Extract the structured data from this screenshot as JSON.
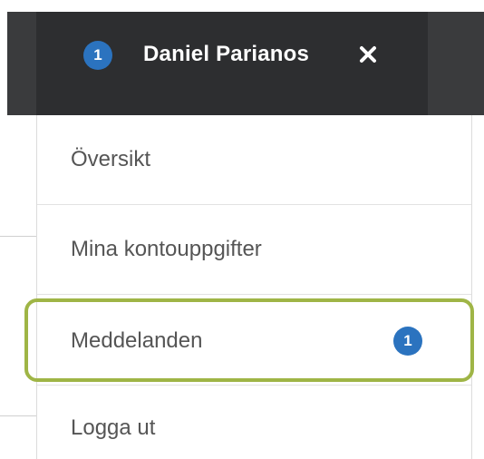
{
  "header": {
    "notification_count": "1",
    "user_name": "Daniel Parianos",
    "close_icon": "close-icon"
  },
  "menu": {
    "items": [
      {
        "label": "Översikt"
      },
      {
        "label": "Mina kontouppgifter"
      },
      {
        "label": "Meddelanden",
        "badge": "1",
        "highlighted": true
      },
      {
        "label": "Logga ut"
      }
    ]
  },
  "colors": {
    "header_bg": "#2d2e30",
    "header_bg_outer": "#3a3b3d",
    "badge": "#2b73bf",
    "highlight": "#9fb546",
    "text": "#555555"
  }
}
